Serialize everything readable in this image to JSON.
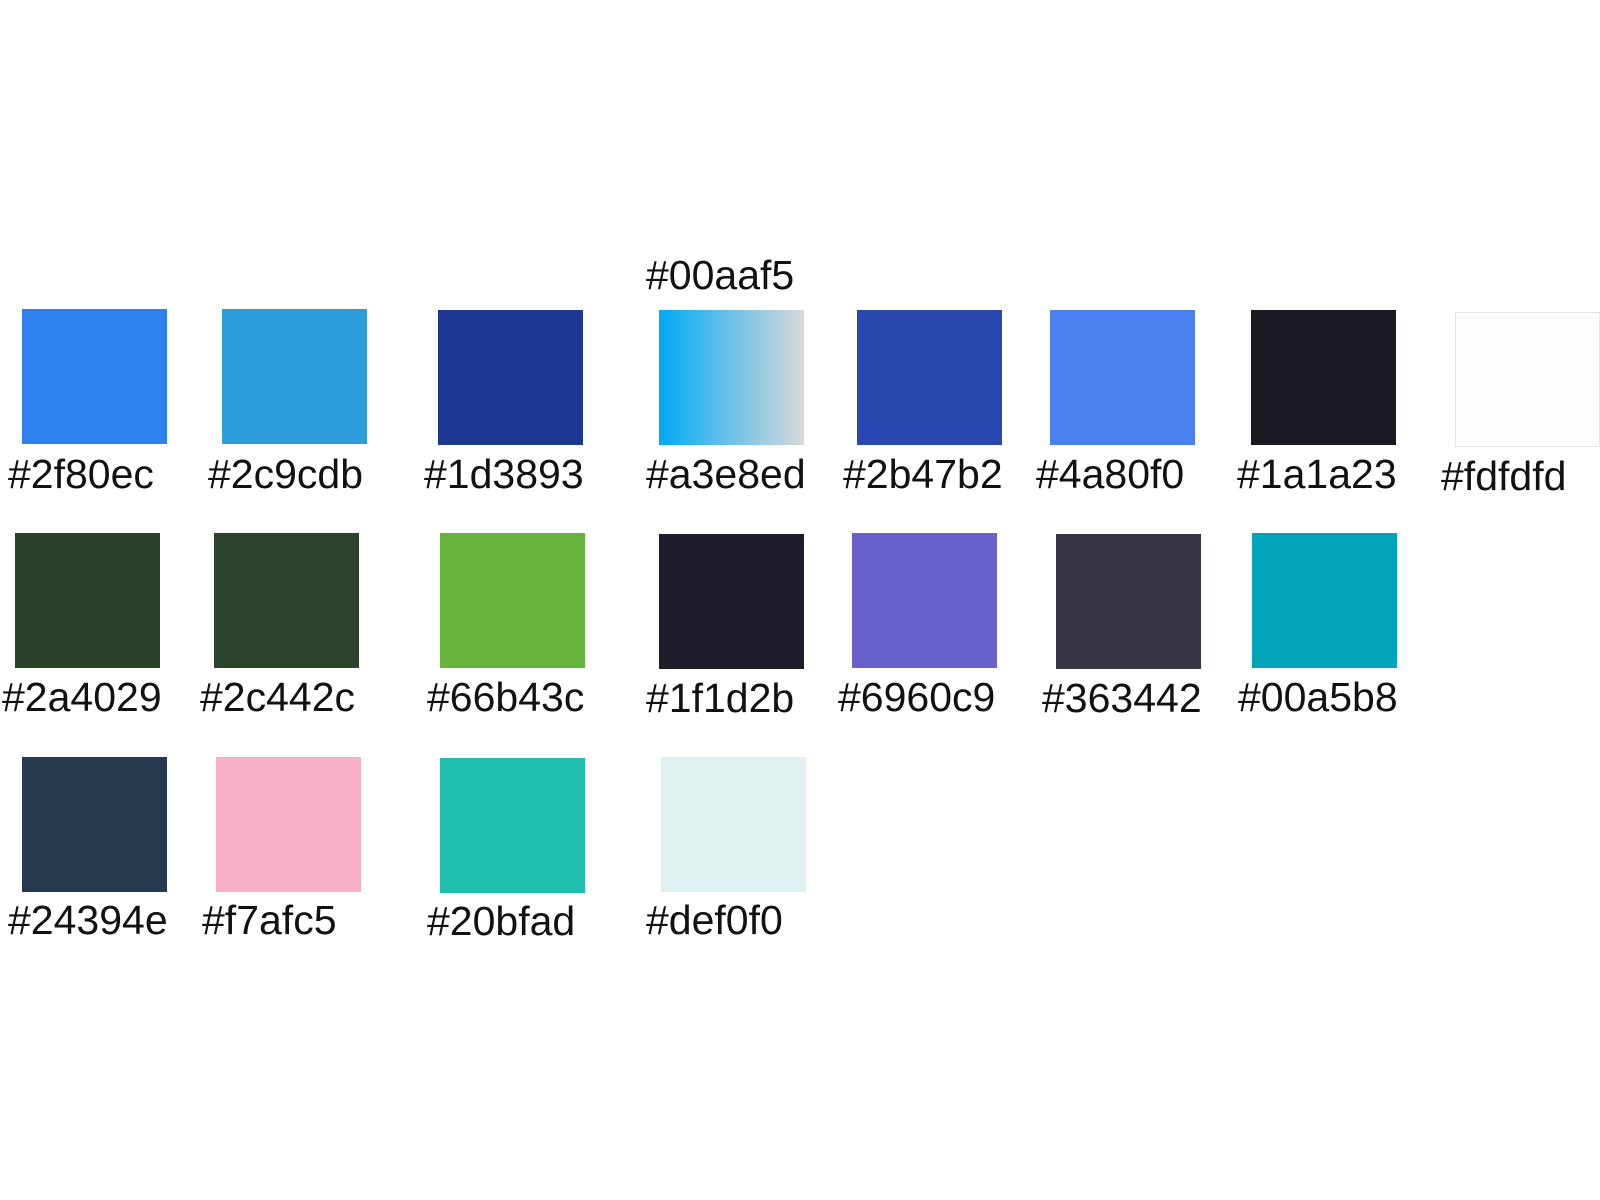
{
  "top_label": "#00aaf5",
  "swatches": [
    {
      "label": "#2f80ec",
      "color": "#2f80ec"
    },
    {
      "label": "#2c9cdb",
      "color": "#2c9cdb"
    },
    {
      "label": "#1d3893",
      "color": "#1d3893"
    },
    {
      "label": "#a3e8ed",
      "color_start": "#00aaf5",
      "color_end": "#d9d9d9"
    },
    {
      "label": "#2b47b2",
      "color": "#2b47b2"
    },
    {
      "label": "#4a80f0",
      "color": "#4a80f0"
    },
    {
      "label": "#1a1a23",
      "color": "#1a1a23"
    },
    {
      "label": "#fdfdfd",
      "color": "#fdfdfd"
    },
    {
      "label": "#2a4029",
      "color": "#2a4029"
    },
    {
      "label": "#2c442c",
      "color": "#2c442c"
    },
    {
      "label": "#66b43c",
      "color": "#66b43c"
    },
    {
      "label": "#1f1d2b",
      "color": "#1f1d2b"
    },
    {
      "label": "#6960c9",
      "color": "#6960c9"
    },
    {
      "label": "#363442",
      "color": "#363442"
    },
    {
      "label": "#00a5b8",
      "color": "#00a5b8"
    },
    {
      "label": "#24394e",
      "color": "#24394e"
    },
    {
      "label": "#f7afc5",
      "color": "#f7afc5"
    },
    {
      "label": "#20bfad",
      "color": "#20bfad"
    },
    {
      "label": "#def0f0",
      "color": "#def0f0"
    }
  ]
}
